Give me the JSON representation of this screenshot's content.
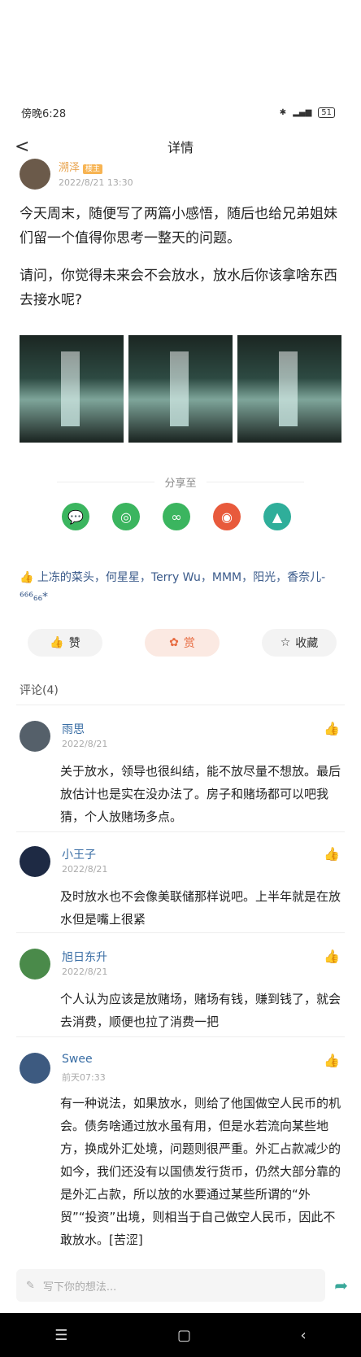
{
  "status": {
    "time": "傍晚6:28",
    "battery": "51"
  },
  "nav": {
    "back": "<",
    "title": "详情"
  },
  "author": {
    "name": "溯泽",
    "badge": "楼主",
    "date": "2022/8/21 13:30"
  },
  "post": {
    "p1": "今天周末，随便写了两篇小感悟，随后也给兄弟姐妹们留一个值得你思考一整天的问题。",
    "p2": "请问，你觉得未来会不会放水，放水后你该拿啥东西去接水呢?"
  },
  "share": {
    "label": "分享至"
  },
  "likes": {
    "text": "上冻的菜头，何星星，Terry Wu，MMM，阳光，香奈儿-⁶⁶⁶₆₆*"
  },
  "actions": {
    "like": "赞",
    "reward": "赏",
    "collect": "收藏"
  },
  "comments_title": "评论(4)",
  "comments": [
    {
      "name": "雨思",
      "date": "2022/8/21",
      "text": "关于放水，领导也很纠结，能不放尽量不想放。最后放估计也是实在没办法了。房子和赌场都可以吧我猜，个人放赌场多点。"
    },
    {
      "name": "小王子",
      "date": "2022/8/21",
      "text": "及时放水也不会像美联储那样说吧。上半年就是在放水但是嘴上很紧"
    },
    {
      "name": "旭日东升",
      "date": "2022/8/21",
      "text": "个人认为应该是放赌场，赌场有钱，赚到钱了，就会去消费，顺便也拉了消费一把"
    },
    {
      "name": "Swee",
      "date": "前天07:33",
      "text": "有一种说法，如果放水，则给了他国做空人民币的机会。债务啥通过放水虽有用，但是水若流向某些地方，换成外汇处境，问题则很严重。外汇占款减少的如今，我们还没有以国债发行货币，仍然大部分靠的是外汇占款，所以放的水要通过某些所谓的“外贸”“投资”出境，则相当于自己做空人民币，因此不敢放水。[苦涩]"
    }
  ],
  "input": {
    "placeholder": "写下你的想法..."
  },
  "colors": {
    "accent": "#3a6ea5",
    "reward": "#e76a3f"
  }
}
